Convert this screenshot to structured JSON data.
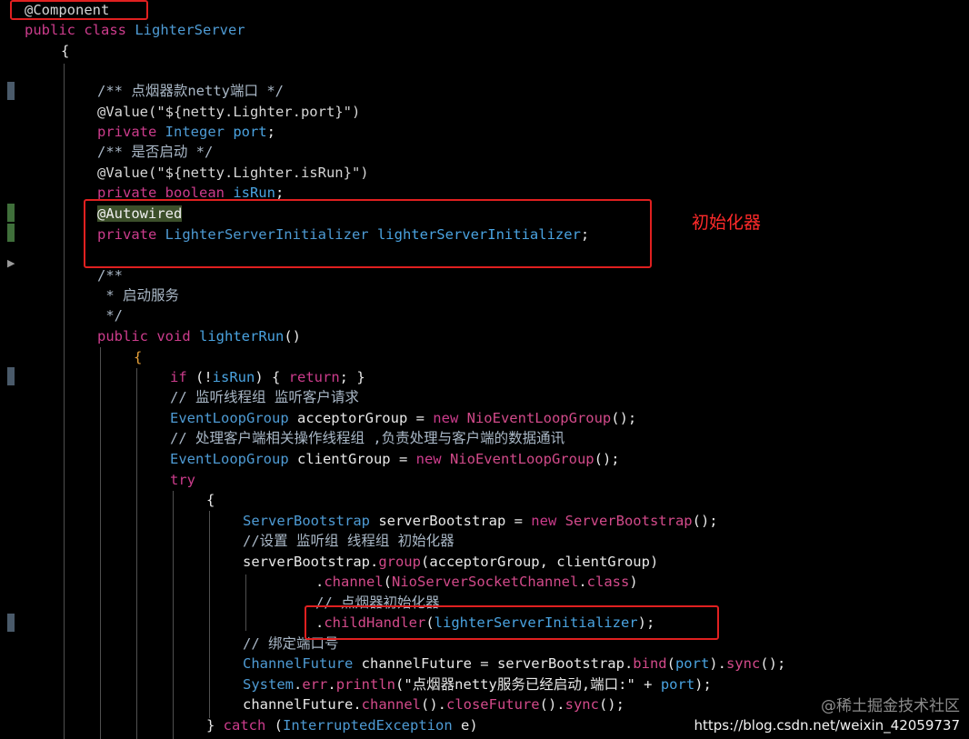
{
  "code": {
    "l1": {
      "t": "@Component"
    },
    "l2": {
      "a": "public class ",
      "b": "LighterServer"
    },
    "l3": {
      "t": "{"
    },
    "l4": {
      "t": "/** 点烟器款netty端口 */"
    },
    "l5": {
      "a": "@Value(",
      "b": "\"${netty.Lighter.port}\"",
      "c": ")"
    },
    "l6": {
      "a": "private ",
      "b": "Integer ",
      "c": "port",
      "d": ";"
    },
    "l7": {
      "t": "/** 是否启动 */"
    },
    "l8": {
      "a": "@Value(",
      "b": "\"${netty.Lighter.isRun}\"",
      "c": ")"
    },
    "l9": {
      "a": "private ",
      "b": "boolean ",
      "c": "isRun",
      "d": ";"
    },
    "l10": {
      "t": "@Autowired"
    },
    "l11": {
      "a": "private ",
      "b": "LighterServerInitializer ",
      "c": "lighterServerInitializer",
      "d": ";"
    },
    "l12": {
      "t": "/**"
    },
    "l13": {
      "t": " * 启动服务"
    },
    "l14": {
      "t": " */"
    },
    "l15": {
      "a": "public ",
      "b": "void ",
      "c": "lighterRun",
      "d": "()"
    },
    "l16": {
      "t": "{"
    },
    "l17": {
      "a": "if ",
      "b": "(!",
      "c": "isRun",
      "d": ") { ",
      "e": "return",
      "f": "; }"
    },
    "l18": {
      "t": "// 监听线程组 监听客户请求"
    },
    "l19": {
      "a": "EventLoopGroup ",
      "b": "acceptorGroup = ",
      "c": "new ",
      "d": "NioEventLoopGroup",
      "e": "();"
    },
    "l20": {
      "t": "// 处理客户端相关操作线程组 ,负责处理与客户端的数据通讯"
    },
    "l21": {
      "a": "EventLoopGroup ",
      "b": "clientGroup = ",
      "c": "new ",
      "d": "NioEventLoopGroup",
      "e": "();"
    },
    "l22": {
      "t": "try"
    },
    "l23": {
      "t": "{"
    },
    "l24": {
      "a": "ServerBootstrap ",
      "b": "serverBootstrap = ",
      "c": "new ",
      "d": "ServerBootstrap",
      "e": "();"
    },
    "l25": {
      "t": "//设置 监听组 线程组 初始化器"
    },
    "l26": {
      "a": "serverBootstrap.",
      "b": "group",
      "c": "(acceptorGroup, clientGroup)"
    },
    "l27": {
      "a": ".",
      "b": "channel",
      "c": "(",
      "d": "NioServerSocketChannel",
      "e": ".",
      "f": "class",
      "g": ")"
    },
    "l28": {
      "t": "// 点烟器初始化器"
    },
    "l29": {
      "a": ".",
      "b": "childHandler",
      "c": "(",
      "d": "lighterServerInitializer",
      "e": ");"
    },
    "l30": {
      "t": "// 绑定端口号"
    },
    "l31": {
      "a": "ChannelFuture ",
      "b": "channelFuture = serverBootstrap.",
      "c": "bind",
      "d": "(",
      "e": "port",
      "f": ").",
      "g": "sync",
      "h": "();"
    },
    "l32": {
      "a": "System",
      "b": ".",
      "c": "err",
      "d": ".",
      "e": "println",
      "f": "(\"点烟器netty服务已经启动,端口:\" + ",
      "g": "port",
      "h": ");"
    },
    "l33": {
      "a": "channelFuture.",
      "b": "channel",
      "c": "().",
      "d": "closeFuture",
      "e": "().",
      "f": "sync",
      "g": "();"
    },
    "l34": {
      "a": "} ",
      "b": "catch ",
      "c": "(",
      "d": "InterruptedException ",
      "e": "e)"
    }
  },
  "annotations": {
    "initializer_note": "初始化器"
  },
  "watermark": {
    "site": "@稀土掘金技术社区",
    "url": "https://blog.csdn.net/weixin_42059737"
  },
  "colors": {
    "background": "#000000",
    "keyword": "#cc3c8c",
    "type": "#4e9bd4",
    "highlight_box": "#e02020"
  }
}
